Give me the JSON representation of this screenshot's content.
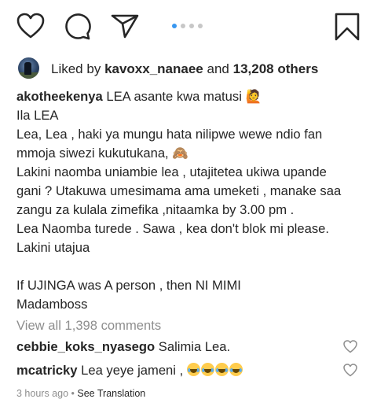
{
  "action_bar": {
    "like_icon": "heart-outline-icon",
    "comment_icon": "comment-bubble-icon",
    "share_icon": "paper-plane-icon",
    "save_icon": "bookmark-icon",
    "carousel": {
      "count": 4,
      "active": 1
    },
    "accent_color": "#3897f0"
  },
  "likes": {
    "prefix": "Liked by",
    "user": "kavoxx_nanaee",
    "connector": "and",
    "others": "13,208 others"
  },
  "caption": {
    "username": "akotheekenya",
    "first_text": "LEA asante kwa matusi 🙋",
    "lines": [
      "Ila LEA",
      "Lea, Lea ,  haki ya mungu hata nilipwe wewe ndio fan",
      "mmoja siwezi kukutukana, 🙈",
      "Lakini naomba uniambie lea ,  utajitetea ukiwa upande",
      "gani ? Utakuwa  umesimama ama umeketi , manake  saa",
      "zangu za kulala zimefika ,nitaamka by 3.00 pm .",
      "Lea Naomba turede . Sawa , kea don't blok mi please.",
      "Lakini utajua",
      "",
      "If  UJINGA was A person , then NI MIMI",
      "Madamboss"
    ]
  },
  "view_all_comments": "View all 1,398 comments",
  "comments": [
    {
      "username": "cebbie_koks_nyasego",
      "text": "Salimia Lea."
    },
    {
      "username": "mcatricky",
      "text": "Lea yeye jameni ,"
    }
  ],
  "footer": {
    "time": "3 hours ago",
    "separator": "•",
    "translate": "See Translation"
  }
}
